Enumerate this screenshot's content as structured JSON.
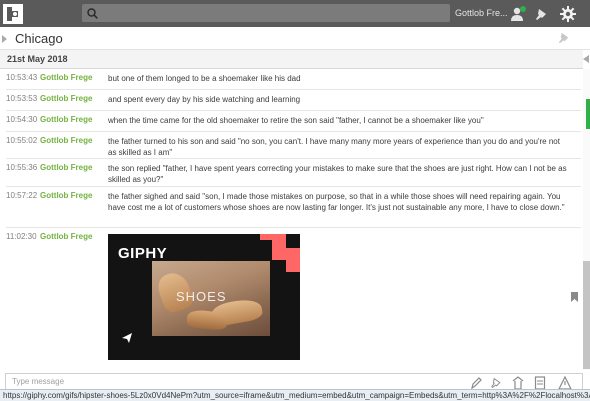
{
  "topbar": {
    "search_placeholder": "",
    "user_name": "Gottlob Fre..."
  },
  "room": {
    "title": "Chicago"
  },
  "date_header": "21st May 2018",
  "messages": [
    {
      "time": "10:53:43",
      "author": "Gottlob Frege",
      "text": "but one of them longed to be a shoemaker like his dad"
    },
    {
      "time": "10:53:53",
      "author": "Gottlob Frege",
      "text": "and spent every day by his side watching and learning"
    },
    {
      "time": "10:54:30",
      "author": "Gottlob Frege",
      "text": "when the time came for the old shoemaker to retire the son said \"father, I cannot be a shoemaker like you\""
    },
    {
      "time": "10:55:02",
      "author": "Gottlob Frege",
      "text": "the father turned to his son and said \"no son, you can't. I have many many more years of experience than you do and you're not as skilled as I am\""
    },
    {
      "time": "10:55:36",
      "author": "Gottlob Frege",
      "text": "the son replied \"father, I have spent years correcting your mistakes to make sure that the shoes are just right. How can I not be as skilled as you?\""
    },
    {
      "time": "10:57:22",
      "author": "Gottlob Frege",
      "text": "the father sighed and said \"son, I made those mistakes on purpose, so that in a while those shoes will need repairing again. You have cost me a lot of customers whose shoes are now lasting far longer. It's just not sustainable any more, I have to close down.\""
    },
    {
      "time": "11:02:30",
      "author": "Gottlob Frege",
      "text": ""
    }
  ],
  "giphy": {
    "logo_text": "GIPHY",
    "overlay_text": "SHOES"
  },
  "composer": {
    "placeholder": "Type message"
  },
  "status_bar": {
    "url": "https://giphy.com/gifs/hipster-shoes-5Lz0x0Vd4NePm?utm_source=iframe&utm_medium=embed&utm_campaign=Embeds&utm_term=http%3A%2F%2Flocalhost%3A%2F"
  },
  "icons": {
    "logo": "app-logo-icon",
    "search": "search-icon",
    "user": "user-icon",
    "notifications": "bell-icon",
    "settings": "gear-icon",
    "pin": "pin-icon",
    "send": "send-icon",
    "bookmark": "bookmark-icon",
    "composer": [
      "pen-icon",
      "pin-icon",
      "upload-icon",
      "document-icon",
      "warning-icon"
    ]
  },
  "colors": {
    "topbar": "#5a5a5a",
    "author": "#74b240",
    "online": "#2fb04a",
    "giphy_accent": "#ff6666"
  }
}
